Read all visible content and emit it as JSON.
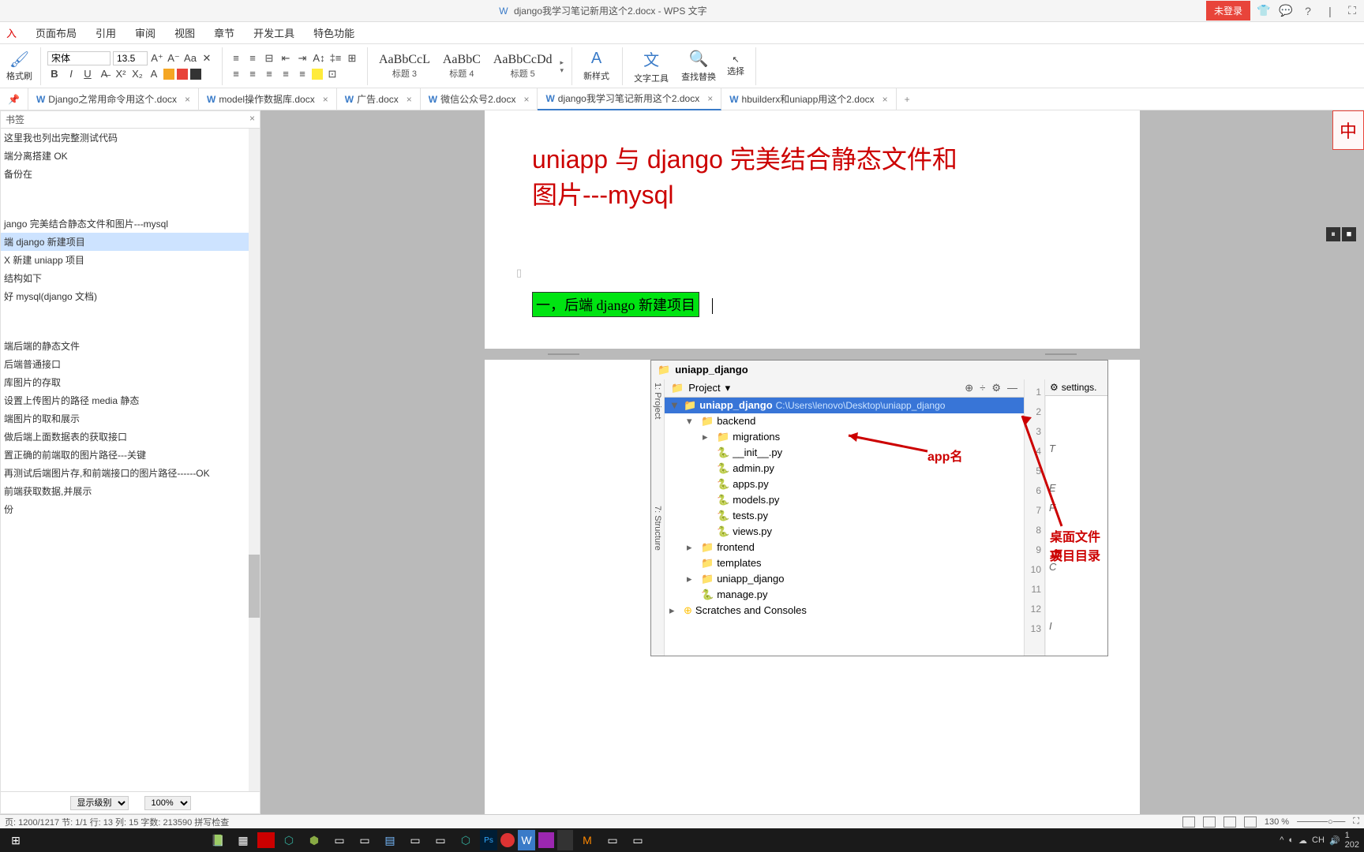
{
  "titlebar": {
    "doc_name": "django我学习笔记新用这个2.docx - WPS 文字",
    "login": "未登录"
  },
  "menu": [
    "入",
    "页面布局",
    "引用",
    "审阅",
    "视图",
    "章节",
    "开发工具",
    "特色功能"
  ],
  "ribbon": {
    "brush": "格式刷",
    "font_name": "宋体",
    "font_size": "13.5",
    "styles": [
      {
        "preview": "AaBbCcL",
        "label": "标题 3"
      },
      {
        "preview": "AaBbC",
        "label": "标题 4"
      },
      {
        "preview": "AaBbCcDd",
        "label": "标题 5"
      }
    ],
    "new_style": "新样式",
    "text_tool": "文字工具",
    "find_replace": "查找替换",
    "select": "选择"
  },
  "tabs": [
    {
      "label": "Django之常用命令用这个.docx",
      "active": false
    },
    {
      "label": "model操作数据库.docx",
      "active": false
    },
    {
      "label": "广告.docx",
      "active": false
    },
    {
      "label": "微信公众号2.docx",
      "active": false
    },
    {
      "label": "django我学习笔记新用这个2.docx",
      "active": true
    },
    {
      "label": "hbuilderx和uniapp用这个2.docx",
      "active": false
    }
  ],
  "sidebar": {
    "title": "书签",
    "items": [
      "这里我也列出完整测试代码",
      "端分离搭建 OK",
      "    备份在",
      "",
      "",
      "jango 完美结合静态文件和图片---mysql",
      "端 django 新建项目",
      "X 新建 uniapp 项目",
      "结构如下",
      "好 mysql(django 文档)",
      "",
      "",
      "端后端的静态文件",
      "后端普通接口",
      "库图片的存取",
      "设置上传图片的路径 media 静态",
      "端图片的取和展示",
      "做后端上面数据表的获取接口",
      "置正确的前端取的图片路径---关键",
      "再测试后端图片存,和前端接口的图片路径------OK",
      "前端获取数据,并展示",
      "份"
    ],
    "selected_index": 6,
    "footer": {
      "level": "显示级别",
      "zoom": "100%"
    }
  },
  "document": {
    "title_line1": "uniapp 与 django 完美结合静态文件和",
    "title_line2": "图片---mysql",
    "section": "一，后端 django 新建项目"
  },
  "embed": {
    "title": "uniapp_django",
    "project": "Project",
    "settings_tab": "settings.",
    "root": {
      "name": "uniapp_django",
      "path": "C:\\Users\\lenovo\\Desktop\\uniapp_django"
    },
    "tree": [
      {
        "level": 1,
        "type": "folder",
        "name": "backend",
        "arrow": "▾"
      },
      {
        "level": 2,
        "type": "folder",
        "name": "migrations",
        "arrow": "▸"
      },
      {
        "level": 2,
        "type": "py",
        "name": "__init__.py"
      },
      {
        "level": 2,
        "type": "py",
        "name": "admin.py"
      },
      {
        "level": 2,
        "type": "py",
        "name": "apps.py"
      },
      {
        "level": 2,
        "type": "py",
        "name": "models.py"
      },
      {
        "level": 2,
        "type": "py",
        "name": "tests.py"
      },
      {
        "level": 2,
        "type": "py",
        "name": "views.py"
      },
      {
        "level": 1,
        "type": "folder",
        "name": "frontend",
        "arrow": "▸"
      },
      {
        "level": 1,
        "type": "folder-pink",
        "name": "templates"
      },
      {
        "level": 1,
        "type": "folder",
        "name": "uniapp_django",
        "arrow": "▸"
      },
      {
        "level": 1,
        "type": "py",
        "name": "manage.py"
      },
      {
        "level": 0,
        "type": "scratch",
        "name": "Scratches and Consoles",
        "arrow": "▸"
      }
    ],
    "line_numbers": [
      "1",
      "2",
      "3",
      "4",
      "5",
      "6",
      "7",
      "8",
      "9",
      "10",
      "11",
      "12",
      "13"
    ],
    "txt_col": [
      "",
      "",
      "T",
      "",
      "E",
      "F",
      "",
      "",
      "C",
      "",
      "",
      "I",
      ""
    ],
    "annot_app": "app名",
    "annot_desktop1": "桌面文件夹",
    "annot_desktop2": "项目目录"
  },
  "status": {
    "left": "页: 1200/1217  节: 1/1  行: 13  列: 15  字数: 213590  拼写检查",
    "zoom": "130 %"
  },
  "tray": {
    "ime": "CH",
    "time": "1",
    "date": "202"
  }
}
